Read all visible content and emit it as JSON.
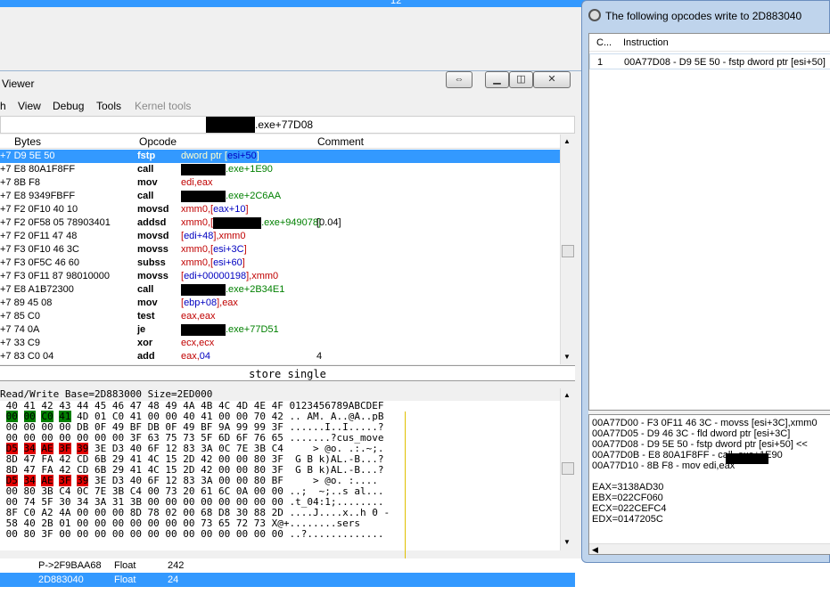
{
  "topbar": {
    "text": "12"
  },
  "memview": {
    "title": "Viewer",
    "menu": [
      "h",
      "View",
      "Debug",
      "Tools",
      "Kernel tools"
    ],
    "address": ".exe+77D08",
    "columns": {
      "bytes": "Bytes",
      "opcode": "Opcode",
      "comment": "Comment"
    },
    "rows": [
      {
        "bytes": "+7 D9 5E 50",
        "op": "fstp",
        "a": "dword ptr [",
        "b": "esi+50",
        "c": "]",
        "comment": ""
      },
      {
        "bytes": "+7 E8 80A1F8FF",
        "op": "call",
        "a": "",
        "b": "",
        "c": ".exe+1E90",
        "comment": ""
      },
      {
        "bytes": "+7 8B F8",
        "op": "mov",
        "a": "edi,eax",
        "b": "",
        "c": "",
        "comment": ""
      },
      {
        "bytes": "+7 E8 9349FBFF",
        "op": "call",
        "a": "",
        "b": "",
        "c": ".exe+2C6AA",
        "comment": ""
      },
      {
        "bytes": "+7 F2 0F10 40 10",
        "op": "movsd",
        "a": "xmm0,[",
        "b": "eax+10",
        "c": "]",
        "comment": ""
      },
      {
        "bytes": "+7 F2 0F58 05 78903401",
        "op": "addsd",
        "a": "xmm0,[",
        "b": "",
        "c": ".exe+949078]",
        "comment": "[0.04]"
      },
      {
        "bytes": "+7 F2 0F11 47 48",
        "op": "movsd",
        "a": "[",
        "b": "edi+48",
        "c": "],xmm0",
        "comment": ""
      },
      {
        "bytes": "+7 F3 0F10 46 3C",
        "op": "movss",
        "a": "xmm0,[",
        "b": "esi+3C",
        "c": "]",
        "comment": ""
      },
      {
        "bytes": "+7 F3 0F5C 46 60",
        "op": "subss",
        "a": "xmm0,[",
        "b": "esi+60",
        "c": "]",
        "comment": ""
      },
      {
        "bytes": "+7 F3 0F11 87 98010000",
        "op": "movss",
        "a": "[",
        "b": "edi+00000198",
        "c": "],xmm0",
        "comment": ""
      },
      {
        "bytes": "+7 E8 A1B72300",
        "op": "call",
        "a": "",
        "b": "",
        "c": ".exe+2B34E1",
        "comment": ""
      },
      {
        "bytes": "+7 89 45 08",
        "op": "mov",
        "a": "[",
        "b": "ebp+08",
        "c": "],eax",
        "comment": ""
      },
      {
        "bytes": "+7 85 C0",
        "op": "test",
        "a": "eax,eax",
        "b": "",
        "c": "",
        "comment": ""
      },
      {
        "bytes": "+7 74 0A",
        "op": "je",
        "a": "",
        "b": "",
        "c": ".exe+77D51",
        "comment": ""
      },
      {
        "bytes": "+7 33 C9",
        "op": "xor",
        "a": "ecx,ecx",
        "b": "",
        "c": "",
        "comment": ""
      },
      {
        "bytes": "+7 83 C0 04",
        "op": "add",
        "a": "eax,",
        "b": "04",
        "c": "",
        "comment": "4"
      }
    ],
    "status": "store single",
    "hex_header": "Read/Write  Base=2D883000 Size=2ED000",
    "hex_cols": " 40 41 42 43 44 45 46 47 48 49 4A 4B 4C 4D 4E 4F 0123456789ABCDEF",
    "hex_lines": [
      " 00 00 C0 41 4D 01 C0 41 00 00 40 41 00 00 70 42 .. AM. A..@A..pB",
      " 00 00 00 00 DB 0F 49 BF DB 0F 49 BF 9A 99 99 3F ......I..I.....?",
      " 00 00 00 00 00 00 00 3F 63 75 73 5F 6D 6F 76 65 .......?cus_move",
      " D5 34 AE 3F 39 3E D3 40 6F 12 83 3A 0C 7E 3B C4     > @o. .:.~;.",
      " 8D 47 FA 42 CD 6B 29 41 4C 15 2D 42 00 00 80 3F  G B k)AL.-B...?",
      " 8D 47 FA 42 CD 6B 29 41 4C 15 2D 42 00 00 80 3F  G B k)AL.-B...?",
      " D5 34 AE 3F 39 3E D3 40 6F 12 83 3A 00 00 80 BF     > @o. :....",
      " 00 80 3B C4 0C 7E 3B C4 00 73 20 61 6C 0A 00 00 ..;  ~;..s al...",
      " 00 74 5F 30 34 3A 31 3B 00 00 00 00 00 00 00 00 .t_04:1;........",
      " 8F C0 A2 4A 00 00 00 8D 78 02 00 68 D8 30 88 2D ....J....x..h 0 -",
      " 58 40 2B 01 00 00 00 00 00 00 00 73 65 72 73 X@+........sers",
      " 00 80 3F 00 00 00 00 00 00 00 00 00 00 00 00 00 ..?............."
    ],
    "bottom_rows": [
      {
        "addr": "P->2F9BAA68",
        "type": "Float",
        "value": "242"
      },
      {
        "addr": "2D883040",
        "type": "Float",
        "value": "24"
      }
    ]
  },
  "opcodes": {
    "title": "The following opcodes write to 2D883040",
    "col_count": "C...",
    "col_instr": "Instruction",
    "rows": [
      {
        "count": "1",
        "instr": "00A77D08 - D9 5E 50  - fstp dword ptr [esi+50]"
      }
    ],
    "detail": [
      "00A77D00 - F3 0F11 46 3C  - movss [esi+3C],xmm0",
      "00A77D05 - D9 46 3C  - fld dword ptr [esi+3C]",
      "00A77D08 - D9 5E 50  - fstp dword ptr [esi+50] <<",
      "00A77D0B - E8 80A1F8FF - call         .exe+1E90",
      "00A77D10 - 8B F8  - mov edi,eax",
      "",
      "EAX=3138AD30",
      "EBX=022CF060",
      "ECX=022CEFC4",
      "EDX=0147205C"
    ]
  },
  "colors": {
    "selection": "#3399ff",
    "highlight_green": "#008000",
    "highlight_red": "#e00000"
  }
}
